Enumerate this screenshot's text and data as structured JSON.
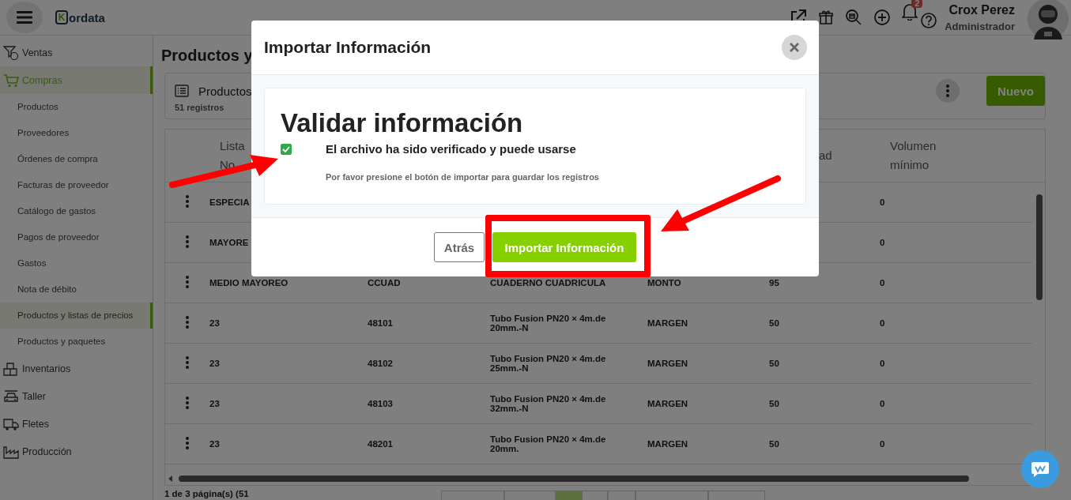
{
  "topbar": {
    "logo": {
      "mark": "K",
      "text": "ordata"
    },
    "notifications": {
      "count": "2"
    },
    "user": {
      "name": "Crox Perez",
      "role": "Administrador"
    }
  },
  "sidebar": {
    "items": [
      {
        "label": "Ventas",
        "selected": false
      },
      {
        "label": "Compras",
        "selected": true,
        "children": [
          {
            "label": "Productos",
            "selected": false
          },
          {
            "label": "Proveedores",
            "selected": false
          },
          {
            "label": "Órdenes de compra",
            "selected": false
          },
          {
            "label": "Facturas de proveedor",
            "selected": false
          },
          {
            "label": "Catálogo de gastos",
            "selected": false
          },
          {
            "label": "Pagos de proveedor",
            "selected": false
          },
          {
            "label": "Gastos",
            "selected": false
          },
          {
            "label": "Nota de débito",
            "selected": false
          },
          {
            "label": "Productos y listas de precios",
            "selected": true
          },
          {
            "label": "Productos y paquetes",
            "selected": false
          }
        ]
      },
      {
        "label": "Inventarios",
        "selected": false
      },
      {
        "label": "Taller",
        "selected": false
      },
      {
        "label": "Fletes",
        "selected": false
      },
      {
        "label": "Producción",
        "selected": false
      }
    ]
  },
  "content": {
    "title": "Productos y",
    "card": {
      "title": "Productos",
      "count": "51 registros",
      "new_button": "Nuevo"
    },
    "table": {
      "columns": [
        {
          "label": "Lista No"
        },
        {
          "label": "ad"
        },
        {
          "label": "Volumen mínimo"
        }
      ],
      "rows": [
        {
          "lista": "ESPECIA",
          "volumen": "0"
        },
        {
          "lista": "MAYORE",
          "volumen": "0"
        },
        {
          "lista": "MEDIO MAYOREO",
          "column_2": "CCUAD",
          "column_3": "CUADERNO CUADRICULA",
          "column_4": "MONTO",
          "column_5": "95",
          "volumen": "0"
        },
        {
          "lista": "23",
          "column_2": "48101",
          "column_3": "Tubo Fusion PN20 × 4m.de 20mm.-N",
          "column_4": "MARGEN",
          "column_5": "50",
          "volumen": "0"
        },
        {
          "lista": "23",
          "column_2": "48102",
          "column_3": "Tubo Fusion PN20 × 4m.de 25mm.-N",
          "column_4": "MARGEN",
          "column_5": "50",
          "volumen": "0"
        },
        {
          "lista": "23",
          "column_2": "48103",
          "column_3": "Tubo Fusion PN20 × 4m.de 32mm.-N",
          "column_4": "MARGEN",
          "column_5": "50",
          "volumen": "0"
        },
        {
          "lista": "23",
          "column_2": "48201",
          "column_3": "Tubo Fusion PN20 × 4m.de 20mm.",
          "column_4": "MARGEN",
          "column_5": "50",
          "volumen": "0"
        }
      ]
    },
    "footer": {
      "pages": "1 de 3 página(s) (51",
      "pager": [
        {
          "selected": false
        },
        {
          "selected": false
        },
        {
          "selected": true
        },
        {
          "selected": false
        },
        {
          "selected": false
        },
        {
          "selected": false
        },
        {
          "selected": false
        }
      ]
    }
  },
  "modal": {
    "title": "Importar Información",
    "heading": "Validar información",
    "check": {
      "label": "El archivo ha sido verificado y puede usarse",
      "checked": true
    },
    "hint": "Por favor presione el botón de importar para guardar los registros",
    "back_button": "Atrás",
    "import_button": "Importar Información"
  },
  "annotations": [
    {
      "kind": "arrow"
    },
    {
      "kind": "arrow"
    },
    {
      "kind": "highlight"
    }
  ]
}
